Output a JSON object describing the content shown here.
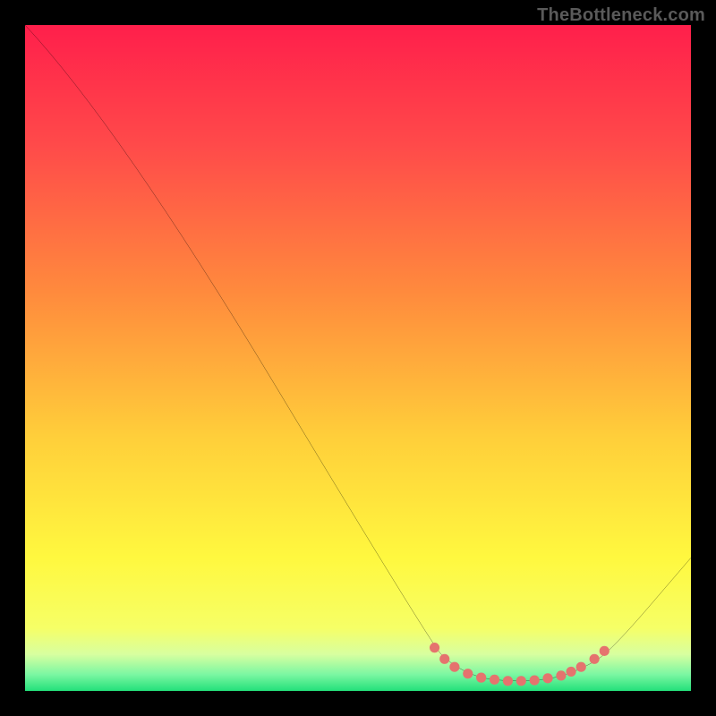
{
  "watermark": "TheBottleneck.com",
  "chart_data": {
    "type": "line",
    "title": "",
    "xlabel": "",
    "ylabel": "",
    "xlim": [
      0,
      100
    ],
    "ylim": [
      0,
      100
    ],
    "grid": false,
    "curve": {
      "name": "bottleneck-curve",
      "color": "#000000",
      "points": [
        {
          "x": 0,
          "y": 100
        },
        {
          "x": 14,
          "y": 85
        },
        {
          "x": 61,
          "y": 7
        },
        {
          "x": 64,
          "y": 4
        },
        {
          "x": 68,
          "y": 2
        },
        {
          "x": 72,
          "y": 1.5
        },
        {
          "x": 76,
          "y": 1.5
        },
        {
          "x": 80,
          "y": 2
        },
        {
          "x": 84,
          "y": 3.5
        },
        {
          "x": 88,
          "y": 6
        },
        {
          "x": 100,
          "y": 20
        }
      ]
    },
    "markers": {
      "name": "sweet-spot-dots",
      "color": "#e5736e",
      "points": [
        {
          "x": 61.5,
          "y": 6.5
        },
        {
          "x": 63,
          "y": 4.8
        },
        {
          "x": 64.5,
          "y": 3.6
        },
        {
          "x": 66.5,
          "y": 2.6
        },
        {
          "x": 68.5,
          "y": 2.0
        },
        {
          "x": 70.5,
          "y": 1.7
        },
        {
          "x": 72.5,
          "y": 1.5
        },
        {
          "x": 74.5,
          "y": 1.5
        },
        {
          "x": 76.5,
          "y": 1.6
        },
        {
          "x": 78.5,
          "y": 1.9
        },
        {
          "x": 80.5,
          "y": 2.3
        },
        {
          "x": 82.0,
          "y": 2.9
        },
        {
          "x": 83.5,
          "y": 3.6
        },
        {
          "x": 85.5,
          "y": 4.8
        },
        {
          "x": 87.0,
          "y": 6.0
        }
      ]
    },
    "gradient_stops": [
      {
        "offset": 0.0,
        "color": "#ff1f4b"
      },
      {
        "offset": 0.18,
        "color": "#ff4a4a"
      },
      {
        "offset": 0.4,
        "color": "#ff8a3d"
      },
      {
        "offset": 0.62,
        "color": "#ffcf3a"
      },
      {
        "offset": 0.8,
        "color": "#fff83f"
      },
      {
        "offset": 0.905,
        "color": "#f6ff66"
      },
      {
        "offset": 0.945,
        "color": "#d8ffa0"
      },
      {
        "offset": 0.975,
        "color": "#7cf7a2"
      },
      {
        "offset": 1.0,
        "color": "#23e07a"
      }
    ]
  }
}
